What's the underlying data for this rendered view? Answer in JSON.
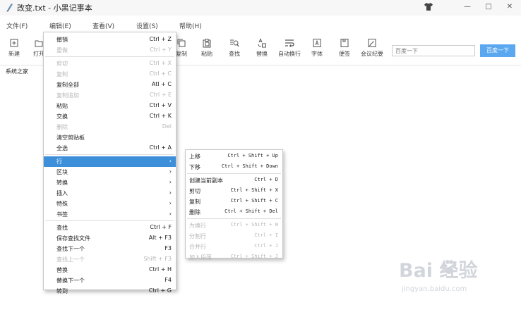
{
  "window": {
    "title": "改变.txt - 小黑记事本",
    "buttons": {
      "minimize": "—",
      "maximize": "□",
      "close": "✕"
    }
  },
  "menubar": [
    "文件(F)",
    "编辑(E)",
    "查看(V)",
    "设置(S)",
    "帮助(H)"
  ],
  "toolbar": {
    "items": [
      {
        "label": "新建",
        "icon": "new-file-icon"
      },
      {
        "label": "打开",
        "icon": "open-folder-icon"
      },
      {
        "label": "复制",
        "icon": "copy-icon"
      },
      {
        "label": "粘贴",
        "icon": "paste-icon"
      },
      {
        "label": "查找",
        "icon": "find-icon"
      },
      {
        "label": "替换",
        "icon": "replace-icon"
      },
      {
        "label": "自动换行",
        "icon": "word-wrap-icon"
      },
      {
        "label": "字体",
        "icon": "font-icon"
      },
      {
        "label": "便签",
        "icon": "note-icon"
      },
      {
        "label": "会议纪要",
        "icon": "meeting-notes-icon"
      }
    ],
    "search_placeholder": "百度一下",
    "search_button": "百度一下"
  },
  "editor": {
    "text": "系统之家"
  },
  "edit_menu": [
    {
      "label": "撤销",
      "shortcut": "Ctrl + Z",
      "enabled": true
    },
    {
      "label": "重做",
      "shortcut": "Ctrl + Y",
      "enabled": false
    },
    {
      "separator": true
    },
    {
      "label": "剪切",
      "shortcut": "Ctrl + X",
      "enabled": false
    },
    {
      "label": "复制",
      "shortcut": "Ctrl + C",
      "enabled": false
    },
    {
      "label": "复制全部",
      "shortcut": "Atl + C",
      "enabled": true
    },
    {
      "label": "复制追加",
      "shortcut": "Ctrl + E",
      "enabled": false
    },
    {
      "label": "粘贴",
      "shortcut": "Ctrl + V",
      "enabled": true
    },
    {
      "label": "交换",
      "shortcut": "Ctrl + K",
      "enabled": true
    },
    {
      "label": "删除",
      "shortcut": "Del",
      "enabled": false
    },
    {
      "label": "清空剪贴板",
      "shortcut": "",
      "enabled": true
    },
    {
      "label": "全选",
      "shortcut": "Ctrl + A",
      "enabled": true
    },
    {
      "separator": true
    },
    {
      "label": "行",
      "shortcut": "›",
      "enabled": true,
      "highlighted": true
    },
    {
      "label": "区块",
      "shortcut": "›",
      "enabled": true
    },
    {
      "label": "转换",
      "shortcut": "›",
      "enabled": true
    },
    {
      "label": "插入",
      "shortcut": "›",
      "enabled": true
    },
    {
      "label": "特殊",
      "shortcut": "›",
      "enabled": true
    },
    {
      "label": "书签",
      "shortcut": "›",
      "enabled": true
    },
    {
      "separator": true
    },
    {
      "label": "查找",
      "shortcut": "Ctrl + F",
      "enabled": true
    },
    {
      "label": "保存查找文件",
      "shortcut": "Alt + F3",
      "enabled": true
    },
    {
      "label": "查找下一个",
      "shortcut": "F3",
      "enabled": true
    },
    {
      "label": "查找上一个",
      "shortcut": "Shift + F3",
      "enabled": false
    },
    {
      "label": "替换",
      "shortcut": "Ctrl + H",
      "enabled": true
    },
    {
      "label": "替换下一个",
      "shortcut": "F4",
      "enabled": true
    },
    {
      "label": "转到",
      "shortcut": "Ctrl + G",
      "enabled": true
    }
  ],
  "line_submenu": [
    {
      "label": "上移",
      "shortcut": "Ctrl + Shift + Up",
      "enabled": true
    },
    {
      "label": "下移",
      "shortcut": "Ctrl + Shift + Down",
      "enabled": true
    },
    {
      "separator": true
    },
    {
      "label": "创建当前副本",
      "shortcut": "Ctrl + D",
      "enabled": true
    },
    {
      "label": "剪切",
      "shortcut": "Ctrl + Shift + X",
      "enabled": true
    },
    {
      "label": "复制",
      "shortcut": "Ctrl + Shift + C",
      "enabled": true
    },
    {
      "label": "删除",
      "shortcut": "Ctrl + Shift + Del",
      "enabled": true
    },
    {
      "separator": true
    },
    {
      "label": "为换行",
      "shortcut": "Ctrl + Shift + W",
      "enabled": false
    },
    {
      "label": "分割行",
      "shortcut": "Ctrl + I",
      "enabled": false
    },
    {
      "label": "合并行",
      "shortcut": "Ctrl + J",
      "enabled": false
    },
    {
      "label": "加入段落",
      "shortcut": "Ctrl + Shift + J",
      "enabled": false
    }
  ],
  "watermark": {
    "brand": "Bai  经验",
    "url": "jingyan.baidu.com"
  }
}
